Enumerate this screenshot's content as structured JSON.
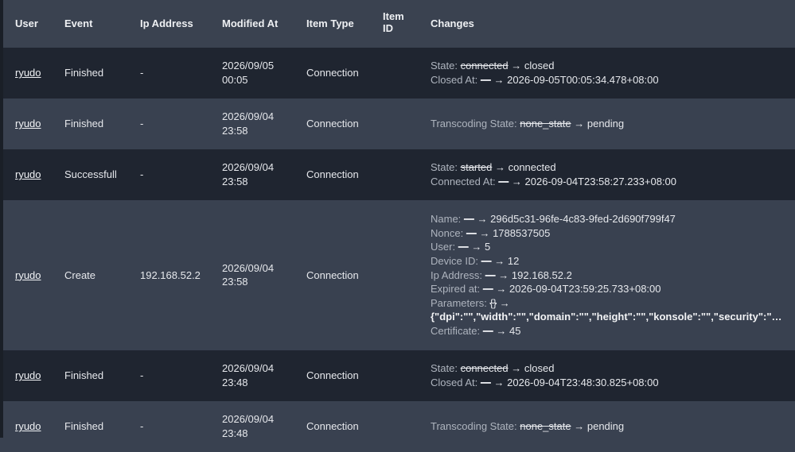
{
  "columns": {
    "user": "User",
    "event": "Event",
    "ip": "Ip Address",
    "modified": "Modified At",
    "type": "Item Type",
    "itemid_1": "Item",
    "itemid_2": "ID",
    "changes": "Changes"
  },
  "arrow": "→",
  "rows": [
    {
      "user": "ryudo",
      "event": "Finished",
      "ip": "-",
      "date": "2026/09/05",
      "time": "00:05",
      "type": "Connection",
      "itemid": "",
      "changes": [
        {
          "label": "State:",
          "from": "connected",
          "to": "closed"
        },
        {
          "label": "Closed At:",
          "from": "—",
          "to": "2026-09-05T00:05:34.478+08:00"
        }
      ]
    },
    {
      "user": "ryudo",
      "event": "Finished",
      "ip": "-",
      "date": "2026/09/04",
      "time": "23:58",
      "type": "Connection",
      "itemid": "",
      "changes": [
        {
          "label": "Transcoding State:",
          "from": "none_state",
          "to": "pending"
        }
      ]
    },
    {
      "user": "ryudo",
      "event": "Successfull",
      "ip": "-",
      "date": "2026/09/04",
      "time": "23:58",
      "type": "Connection",
      "itemid": "",
      "changes": [
        {
          "label": "State:",
          "from": "started",
          "to": "connected"
        },
        {
          "label": "Connected At:",
          "from": "—",
          "to": "2026-09-04T23:58:27.233+08:00"
        }
      ]
    },
    {
      "user": "ryudo",
      "event": "Create",
      "ip": "192.168.52.2",
      "date": "2026/09/04",
      "time": "23:58",
      "type": "Connection",
      "itemid": "",
      "changes": [
        {
          "label": "Name:",
          "from": "—",
          "to": "296d5c31-96fe-4c83-9fed-2d690f799f47"
        },
        {
          "label": "Nonce:",
          "from": "—",
          "to": "1788537505"
        },
        {
          "label": "User:",
          "from": "—",
          "to": "5"
        },
        {
          "label": "Device ID:",
          "from": "—",
          "to": "12"
        },
        {
          "label": "Ip Address:",
          "from": "—",
          "to": "192.168.52.2"
        },
        {
          "label": "Expired at:",
          "from": "—",
          "to": "2026-09-04T23:59:25.733+08:00"
        },
        {
          "label": "Parameters:",
          "from": "{}",
          "to": ""
        },
        {
          "params": "{\"dpi\":\"\",\"width\":\"\",\"domain\":\"\",\"height\":\"\",\"konsole\":\"\",\"security\":\"any\",\"t..."
        },
        {
          "label": "Certificate:",
          "from": "—",
          "to": "45"
        }
      ]
    },
    {
      "user": "ryudo",
      "event": "Finished",
      "ip": "-",
      "date": "2026/09/04",
      "time": "23:48",
      "type": "Connection",
      "itemid": "",
      "changes": [
        {
          "label": "State:",
          "from": "connected",
          "to": "closed"
        },
        {
          "label": "Closed At:",
          "from": "—",
          "to": "2026-09-04T23:48:30.825+08:00"
        }
      ]
    },
    {
      "user": "ryudo",
      "event": "Finished",
      "ip": "-",
      "date": "2026/09/04",
      "time": "23:48",
      "type": "Connection",
      "itemid": "",
      "changes": [
        {
          "label": "Transcoding State:",
          "from": "none_state",
          "to": "pending"
        }
      ]
    }
  ]
}
